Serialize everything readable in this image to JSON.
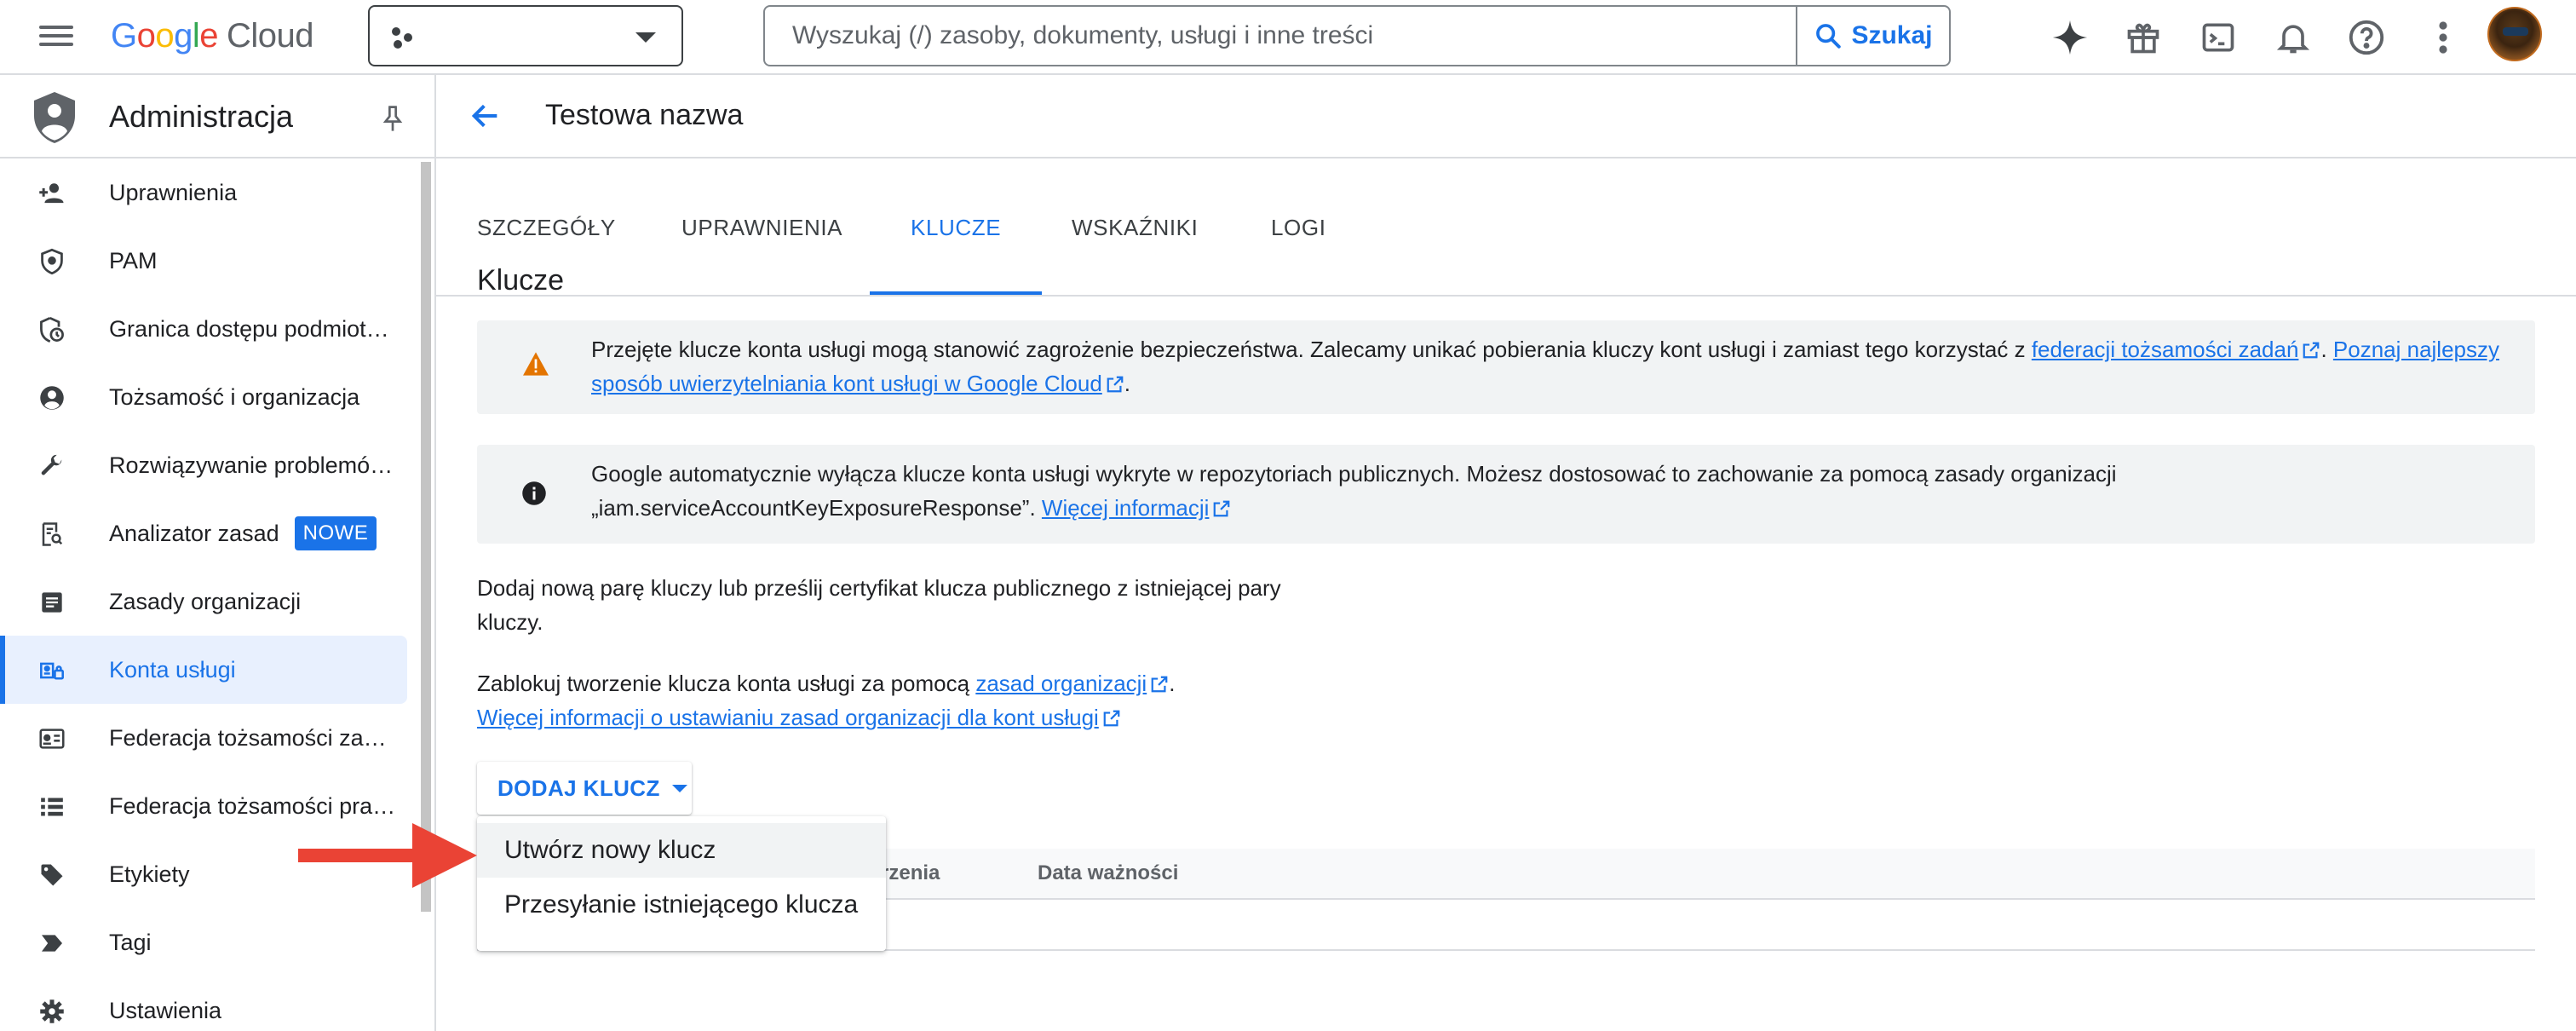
{
  "topbar": {
    "logo_google": "Google",
    "logo_cloud": "Cloud",
    "search_placeholder": "Wyszukaj (/) zasoby, dokumenty, usługi i inne treści",
    "search_button": "Szukaj",
    "icons": [
      "menu-icon",
      "project-icon",
      "gemini-icon",
      "gift-icon",
      "cloud-shell-icon",
      "notifications-icon",
      "help-icon",
      "more-vert-icon"
    ]
  },
  "sidebar": {
    "title": "Administracja",
    "items": [
      {
        "label": "Uprawnienia",
        "icon": "person-add-icon"
      },
      {
        "label": "PAM",
        "icon": "shield-icon"
      },
      {
        "label": "Granica dostępu podmiot…",
        "icon": "shield-clock-icon"
      },
      {
        "label": "Tożsamość i organizacja",
        "icon": "account-circle-icon"
      },
      {
        "label": "Rozwiązywanie problemó…",
        "icon": "wrench-icon"
      },
      {
        "label": "Analizator zasad",
        "icon": "policy-doc-icon",
        "badge": "NOWE"
      },
      {
        "label": "Zasady organizacji",
        "icon": "article-icon"
      },
      {
        "label": "Konta usługi",
        "icon": "service-account-icon",
        "active": true
      },
      {
        "label": "Federacja tożsamości za…",
        "icon": "badge-icon"
      },
      {
        "label": "Federacja tożsamości pra…",
        "icon": "list-icon"
      },
      {
        "label": "Etykiety",
        "icon": "tag-icon"
      },
      {
        "label": "Tagi",
        "icon": "label-arrow-icon"
      },
      {
        "label": "Ustawienia",
        "icon": "settings-icon"
      }
    ]
  },
  "page": {
    "title": "Testowa nazwa",
    "tabs": [
      "SZCZEGÓŁY",
      "UPRAWNIENIA",
      "KLUCZE",
      "WSKAŹNIKI",
      "LOGI"
    ],
    "active_tab": "KLUCZE",
    "section_title": "Klucze",
    "warning": {
      "text1": "Przejęte klucze konta usługi mogą stanowić zagrożenie bezpieczeństwa. Zalecamy unikać pobierania kluczy kont usługi i zamiast tego korzystać z ",
      "link1": "federacji tożsamości zadań",
      "text2": ". ",
      "link2a": "Poznaj najlepszy",
      "link2b": "sposób uwierzytelniania kont usługi w Google Cloud",
      "text3": "."
    },
    "info": {
      "line1": "Google automatycznie wyłącza klucze konta usługi wykryte w repozytoriach publicznych. Możesz dostosować to zachowanie za pomocą zasady organizacji",
      "line2": "„iam.serviceAccountKeyExposureResponse”. ",
      "link": "Więcej informacji"
    },
    "add_text_line1": "Dodaj nową parę kluczy lub prześlij certyfikat klucza publicznego z istniejącej pary",
    "add_text_line2": "kluczy.",
    "block_text": "Zablokuj tworzenie klucza konta usługi za pomocą ",
    "block_link": "zasad organizacji",
    "block_end": ".",
    "more_link": "Więcej informacji o ustawianiu zasad organizacji dla kont usługi",
    "add_key_button": "DODAJ KLUCZ",
    "table_headers": [
      "Data utworzenia",
      "Data ważności"
    ],
    "table_header_visible_fragment": "rzenia",
    "menu": [
      "Utwórz nowy klucz",
      "Przesyłanie istniejącego klucza"
    ]
  },
  "colors": {
    "accent": "#1a73e8",
    "arrow": "#ea4335",
    "warning": "#e37400"
  }
}
